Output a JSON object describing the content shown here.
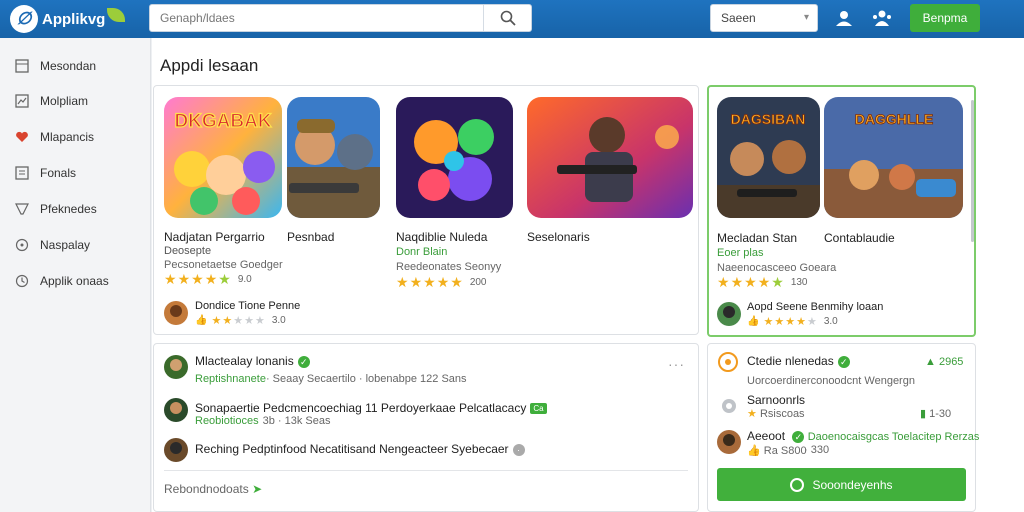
{
  "header": {
    "logo_text": "Applikvg",
    "search_placeholder": "Genaph/ldaes",
    "select_value": "Saeen",
    "cta_label": "Benpma"
  },
  "sidebar": {
    "items": [
      {
        "label": "Mesondan",
        "icon": "grid-icon"
      },
      {
        "label": "Molpliam",
        "icon": "chart-icon"
      },
      {
        "label": "Mlapancis",
        "icon": "heart-icon"
      },
      {
        "label": "Fonals",
        "icon": "list-icon"
      },
      {
        "label": "Pfeknedes",
        "icon": "tag-icon"
      },
      {
        "label": "Naspalay",
        "icon": "gamepad-icon"
      },
      {
        "label": "Applik onaas",
        "icon": "clock-icon"
      }
    ]
  },
  "main": {
    "section_title": "Appdi lesaan"
  },
  "apps": {
    "card1": {
      "thumb1_text": "DKGABAK",
      "title_left": "Nadjatan Pergarrio",
      "title_right": "Pesnbad",
      "sub": "Deosepte",
      "meta": "Pecsonetaetse Goedger",
      "rating": "9.0",
      "dev_name": "Dondice Tione Penne",
      "dev_rating": "3.0"
    },
    "card2": {
      "title": "Naqdiblie Nuleda",
      "sub": "Donr Blain",
      "meta": "Reedeonates Seonyy",
      "rating": "200"
    },
    "card3": {
      "title": "Seselonaris"
    },
    "featured": {
      "thumb1_text": "DAGSIBAN",
      "thumb2_text": "DAGGHLLE",
      "title_left": "Mecladan Stan",
      "title_right": "Contablaudie",
      "sub": "Eoer plas",
      "meta": "Naeenocasceeo Goeara",
      "rating": "130",
      "dev_name": "Aopd Seene Benmihy loaan",
      "dev_rating": "3.0"
    }
  },
  "activity": {
    "rows": [
      {
        "title": "Mlactealay lonanis",
        "sub_green": "Reptishnanete",
        "sub": "· Seaay Secaertilo · lobenabpe 122 Sans",
        "more": "···"
      },
      {
        "title": "Sonapaertie Pedcmencoechiag 11 Perdoyerkaae Pelcatlacacy",
        "tag": "Ca",
        "sub_green": "Reobiotioces",
        "sub": "3b · 13k Seas"
      },
      {
        "title": "Reching Pedptinfood Necatitisand Nengeacteer Syebecaer",
        "sub": ""
      }
    ],
    "footer_link": "Rebondnodoats"
  },
  "right_panel": {
    "rows": [
      {
        "title": "Ctedie nlenedas",
        "count": "2965",
        "sub": "Uorcoerdinerconoodcnt Wengergn"
      },
      {
        "title": "Sarnoonrls",
        "sub": "Rsiscoas",
        "count": "1-30"
      },
      {
        "title": "Aeeoot",
        "sub_green": "Daoenocaisgcas Toelacitep Rerzas",
        "sub": "Ra S800",
        "count": "330"
      }
    ],
    "button_label": "Sooondeyenhs"
  },
  "colors": {
    "topbar": "#1c6ab4",
    "accent_green": "#3fae3b",
    "star": "#f2b01e"
  }
}
